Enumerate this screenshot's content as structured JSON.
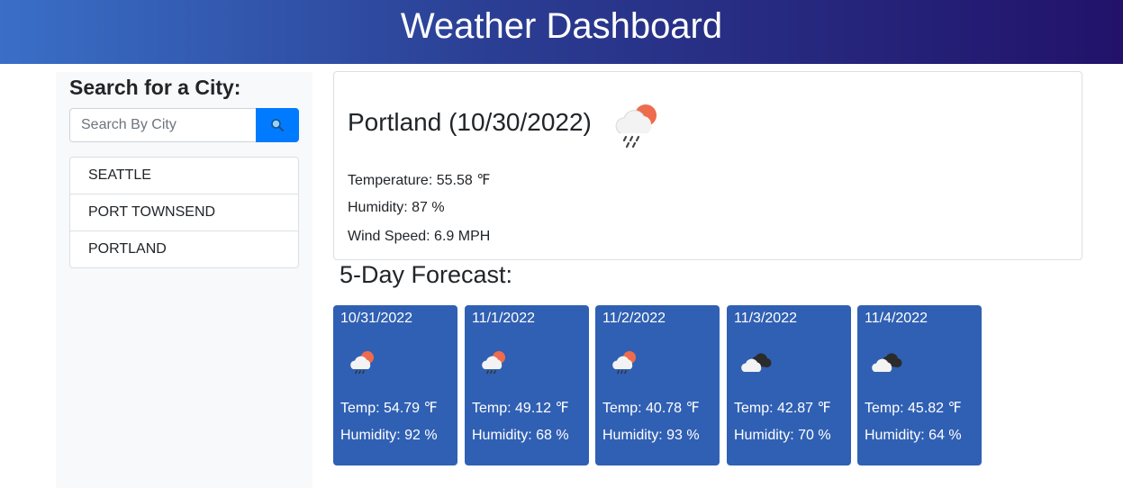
{
  "header": {
    "title": "Weather Dashboard"
  },
  "sidebar": {
    "heading": "Search for a City:",
    "search": {
      "placeholder": "Search By City",
      "value": ""
    },
    "search_button_icon": "search-icon",
    "cities": [
      "SEATTLE",
      "PORT TOWNSEND",
      "PORTLAND"
    ]
  },
  "current": {
    "title": "Portland (10/30/2022)",
    "icon": "rain-cloud-sun-icon",
    "temperature": "Temperature: 55.58 ℉",
    "humidity": "Humidity: 87 %",
    "wind": "Wind Speed: 6.9 MPH"
  },
  "forecast": {
    "heading": "5-Day Forecast:",
    "days": [
      {
        "date": "10/31/2022",
        "icon": "rain-cloud-sun-icon",
        "temp": "Temp: 54.79 ℉",
        "humidity": "Humidity: 92 %"
      },
      {
        "date": "11/1/2022",
        "icon": "rain-cloud-sun-icon",
        "temp": "Temp: 49.12 ℉",
        "humidity": "Humidity: 68 %"
      },
      {
        "date": "11/2/2022",
        "icon": "rain-cloud-sun-icon",
        "temp": "Temp: 40.78 ℉",
        "humidity": "Humidity: 93 %"
      },
      {
        "date": "11/3/2022",
        "icon": "broken-clouds-icon",
        "temp": "Temp: 42.87 ℉",
        "humidity": "Humidity: 70 %"
      },
      {
        "date": "11/4/2022",
        "icon": "broken-clouds-icon",
        "temp": "Temp: 45.82 ℉",
        "humidity": "Humidity: 64 %"
      }
    ]
  },
  "colors": {
    "header_start": "#3a6fc7",
    "header_end": "#22126a",
    "search_button": "#007bff",
    "forecast_card": "#3060b3",
    "sidebar_bg": "#f8f9fa"
  }
}
